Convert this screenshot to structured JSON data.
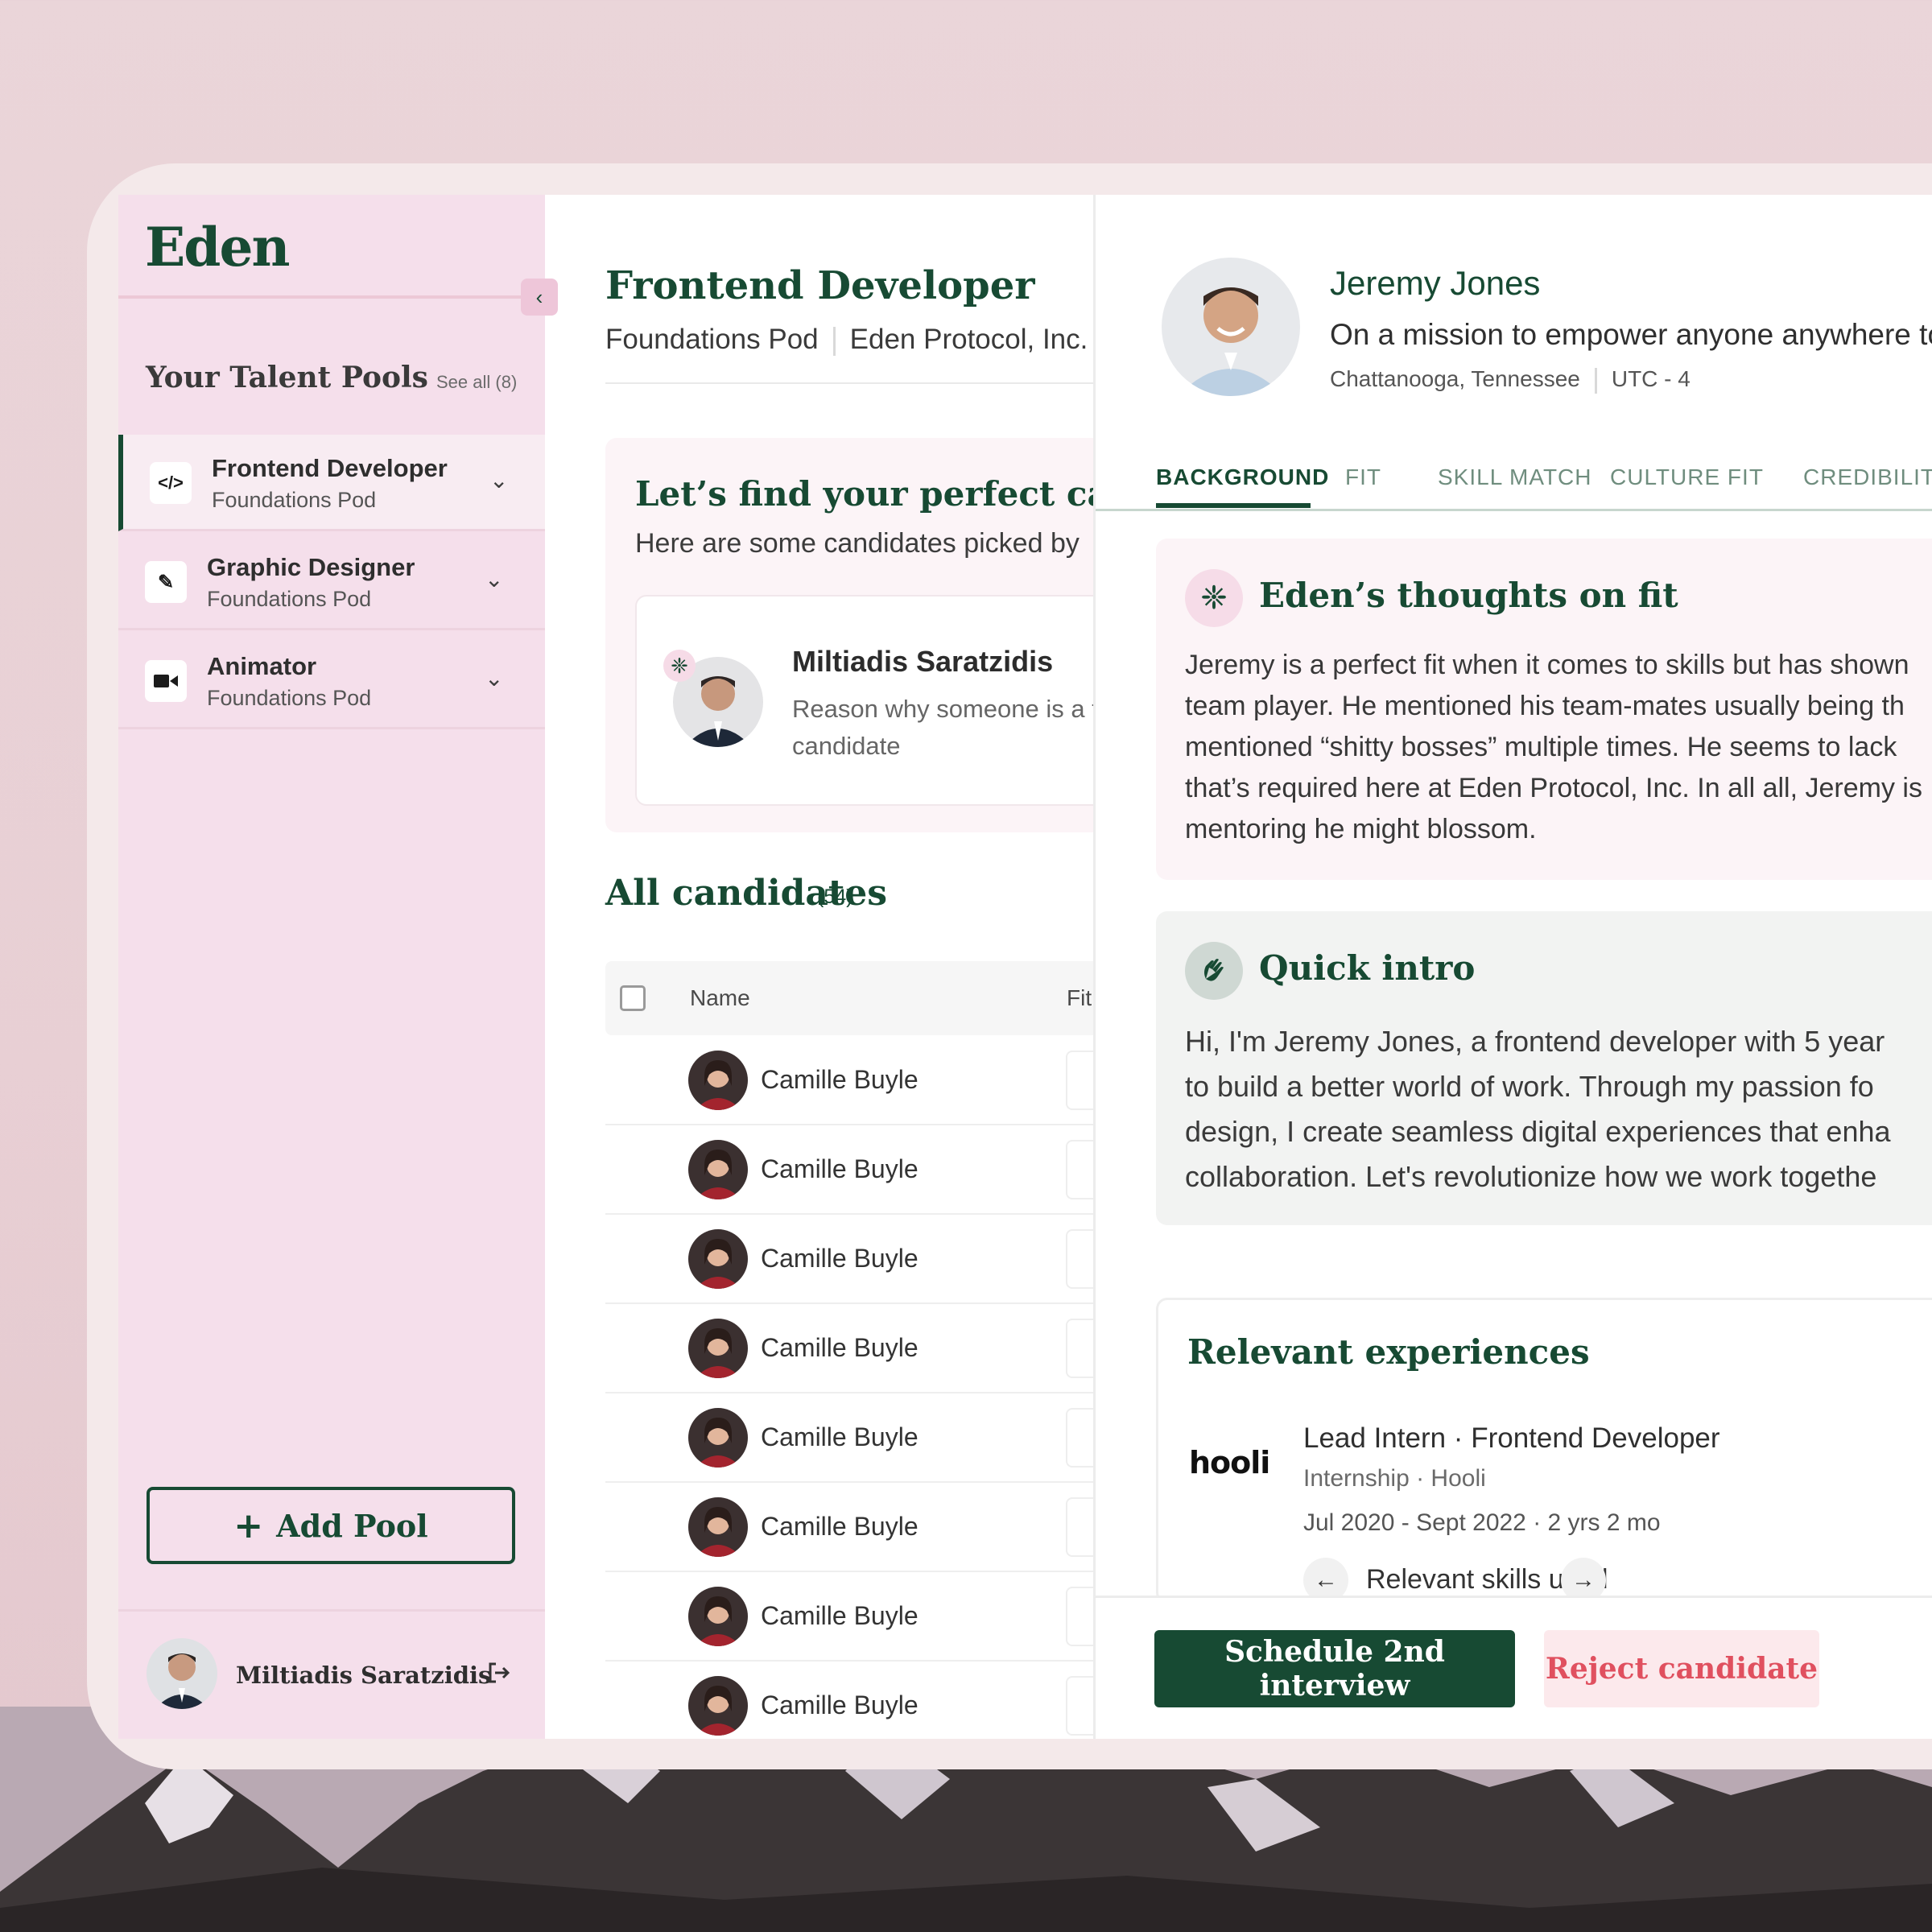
{
  "sidebar": {
    "logo": "Eden",
    "collapse_icon": "chevron-left-icon",
    "pools_title": "Your Talent Pools",
    "see_all": "See all (8)",
    "pools": [
      {
        "name": "Frontend Developer",
        "pod": "Foundations Pod",
        "icon": "code-icon",
        "icon_glyph": "</>",
        "active": true
      },
      {
        "name": "Graphic Designer",
        "pod": "Foundations Pod",
        "icon": "pencil-icon",
        "icon_glyph": "✎",
        "active": false
      },
      {
        "name": "Animator",
        "pod": "Foundations Pod",
        "icon": "video-camera-icon",
        "icon_glyph": "■◂",
        "active": false
      }
    ],
    "add_pool": "Add Pool",
    "user_name": "Miltiadis Saratzidis"
  },
  "job": {
    "title": "Frontend Developer",
    "pod": "Foundations Pod",
    "company": "Eden Protocol, Inc."
  },
  "find": {
    "title": "Let’s find your perfect candidate",
    "subtitle": "Here are some candidates picked by",
    "candidate_name": "Miltiadis Saratzidis",
    "candidate_reason": "Reason why someone is a t candidate"
  },
  "all_candidates": {
    "title": "All candidates",
    "count": "(54)",
    "col_name": "Name",
    "col_fit": "Fit",
    "rows": [
      {
        "name": "Camille Buyle"
      },
      {
        "name": "Camille Buyle"
      },
      {
        "name": "Camille Buyle"
      },
      {
        "name": "Camille Buyle"
      },
      {
        "name": "Camille Buyle"
      },
      {
        "name": "Camille Buyle"
      },
      {
        "name": "Camille Buyle"
      },
      {
        "name": "Camille Buyle"
      }
    ]
  },
  "profile": {
    "name": "Jeremy Jones",
    "mission": "On a mission to empower anyone anywhere to",
    "location": "Chattanooga, Tennessee",
    "timezone": "UTC - 4",
    "tabs": [
      "BACKGROUND",
      "FIT",
      "SKILL MATCH",
      "CULTURE FIT",
      "CREDIBILITY"
    ],
    "active_tab": "BACKGROUND"
  },
  "thoughts": {
    "title": "Eden’s thoughts on fit",
    "body": "Jeremy is a perfect fit when it comes to skills but has shown\nteam player. He mentioned his team-mates usually being th\nmentioned “shitty bosses” multiple times. He seems to lack\nthat’s required here at Eden Protocol, Inc. In all all, Jeremy is\nmentoring he might blossom."
  },
  "intro": {
    "title": "Quick intro",
    "body": "Hi, I'm Jeremy Jones, a frontend developer with 5 year\nto build a better world of work. Through my passion fo\ndesign, I create seamless digital experiences that enha\ncollaboration. Let's revolutionize how we work togethe"
  },
  "experience": {
    "title": "Relevant experiences",
    "logo_text": "hooli",
    "role": "Lead Intern · Frontend Developer",
    "type": "Internship · Hooli",
    "dates": "Jul 2020 - Sept 2022 · 2 yrs 2 mo",
    "skills_label": "Relevant skills used"
  },
  "actions": {
    "schedule": "Schedule 2nd interview",
    "reject": "Reject candidate"
  },
  "colors": {
    "brand_green": "#174a33",
    "sidebar_pink": "#f5dfeb",
    "reject_red": "#e0505f"
  }
}
